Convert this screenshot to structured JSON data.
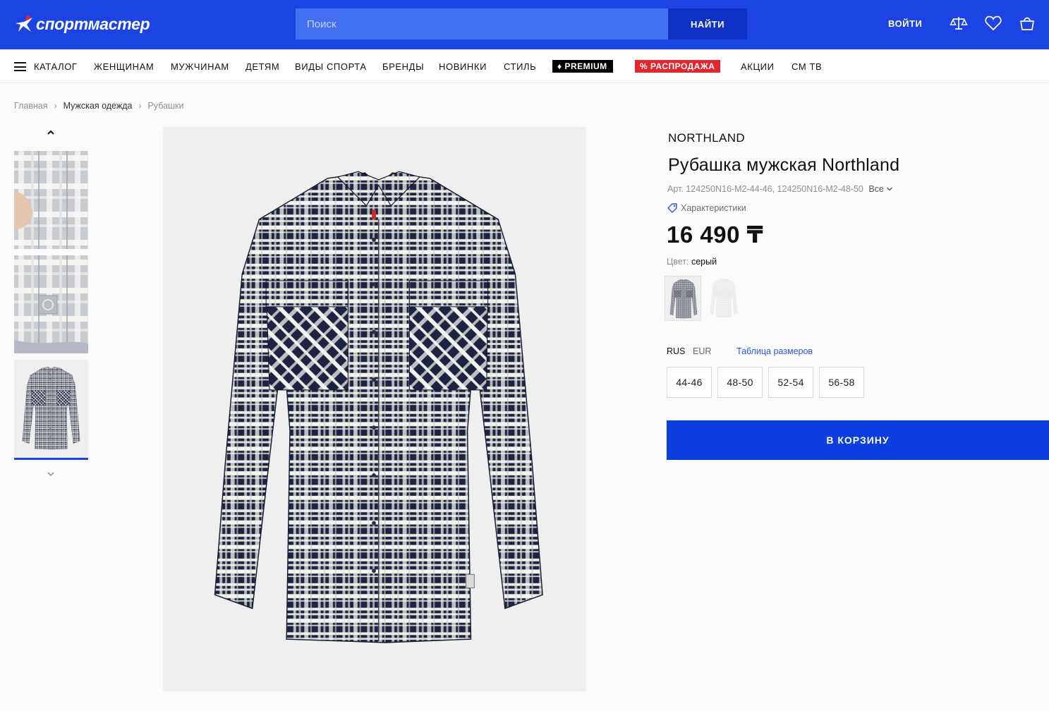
{
  "header": {
    "logo_text": "спортмастер",
    "search_placeholder": "Поиск",
    "search_button": "НАЙТИ",
    "login": "ВОЙТИ",
    "icons": [
      "compare-icon",
      "heart-icon",
      "cart-icon"
    ],
    "brand_color": "#1b44e2"
  },
  "nav": {
    "catalog": "КАТАЛОГ",
    "women": "ЖЕНЩИНАМ",
    "men": "МУЖЧИНАМ",
    "kids": "ДЕТЯМ",
    "sports": "ВИДЫ СПОРТА",
    "brands": "БРЕНДЫ",
    "new": "НОВИНКИ",
    "style": "СТИЛЬ",
    "premium": "PREMIUM",
    "sale": "% РАСПРОДАЖА",
    "promos": "АКЦИИ",
    "cm_tv": "СМ ТВ"
  },
  "breadcrumb": {
    "home": "Главная",
    "category": "Мужская одежда",
    "current": "Рубашки"
  },
  "product": {
    "brand": "NORTHLAND",
    "title": "Рубашка мужская Northland",
    "article": "Арт. 124250N16-M2-44-46, 124250N16-M2-48-50",
    "article_all": "Все",
    "specs_link": "Характеристики",
    "price": "16 490 ₸",
    "color_label": "Цвет:",
    "color_value": "серый",
    "size_systems": [
      "RUS",
      "EUR"
    ],
    "size_table_link": "Таблица размеров",
    "sizes": [
      "44-46",
      "48-50",
      "52-54",
      "56-58"
    ],
    "add_to_cart": "В КОРЗИНУ"
  },
  "gallery": {
    "selected_thumbnail": 3,
    "thumbnails": 3
  },
  "colors": {
    "accent": "#1b44e2",
    "button": "#0c3dde",
    "sale": "#e3262e",
    "premium": "#000000"
  }
}
